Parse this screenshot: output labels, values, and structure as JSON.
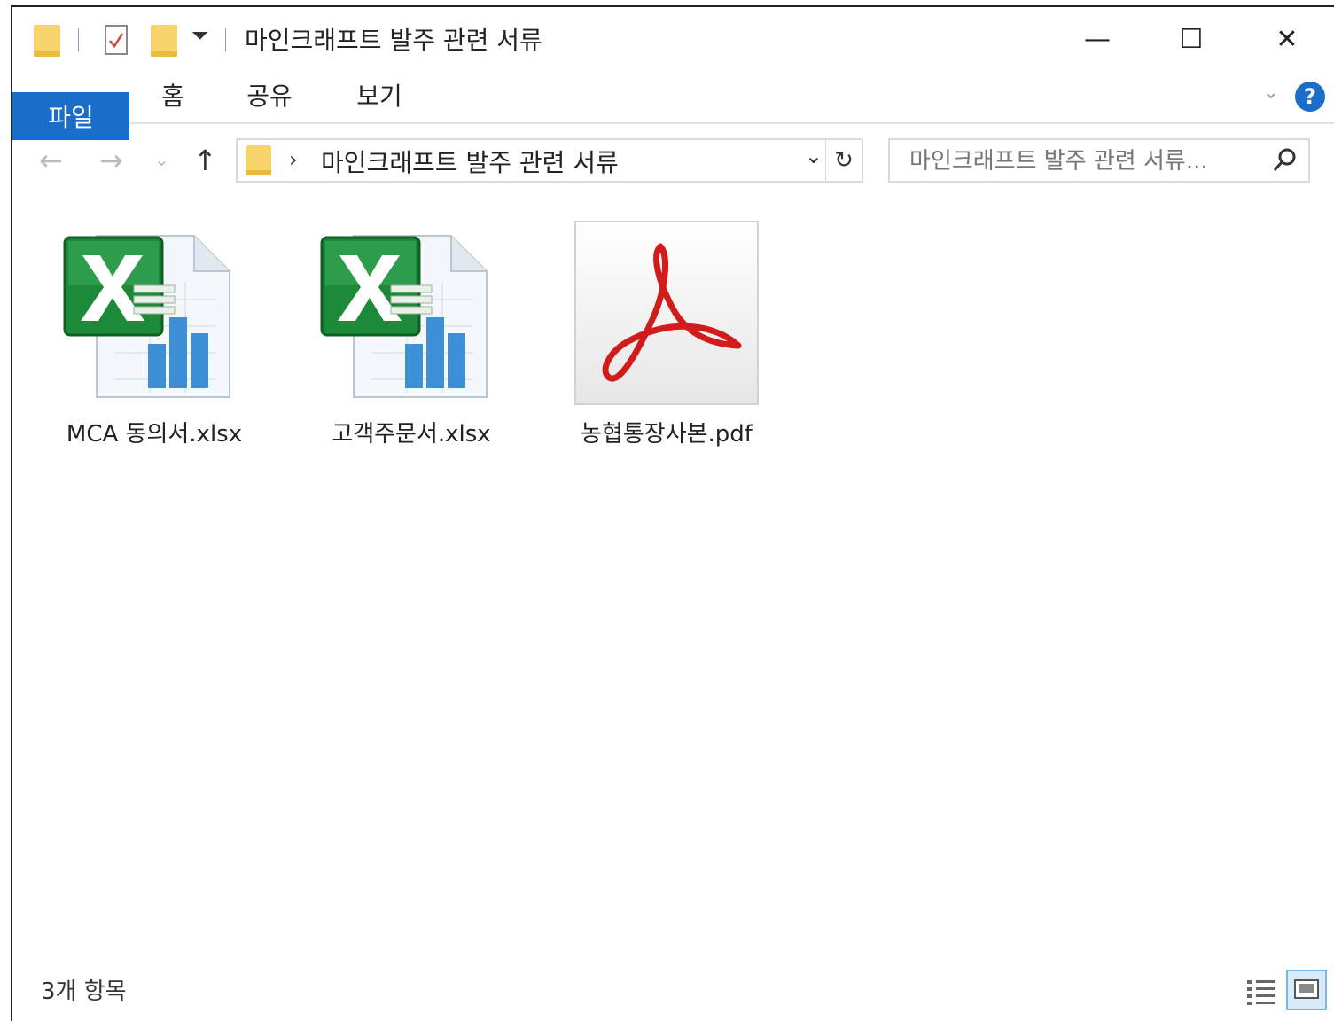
{
  "window": {
    "title": "마인크래프트 발주 관련 서류",
    "minimize_glyph": "—",
    "maximize_glyph": "☐",
    "close_glyph": "✕"
  },
  "quick_access": {
    "dropdown_glyph": "⏷"
  },
  "ribbon": {
    "tabs": [
      {
        "label": "파일"
      },
      {
        "label": "홈"
      },
      {
        "label": "공유"
      },
      {
        "label": "보기"
      }
    ],
    "collapse_glyph": "⌄",
    "help_glyph": "?"
  },
  "navigation": {
    "back_glyph": "←",
    "forward_glyph": "→",
    "recent_glyph": "⌄",
    "up_glyph": "↑",
    "address_separator": "›",
    "address_crumb": "마인크래프트 발주 관련 서류",
    "address_dropdown_glyph": "⌄",
    "refresh_glyph": "↻",
    "search_placeholder": "마인크래프트 발주 관련 서류..."
  },
  "files": [
    {
      "name": "MCA 동의서.xlsx",
      "type": "excel"
    },
    {
      "name": "고객주문서.xlsx",
      "type": "excel"
    },
    {
      "name": "농협통장사본.pdf",
      "type": "pdf"
    }
  ],
  "status": {
    "item_count": "3개 항목"
  },
  "colors": {
    "accent": "#1a6ec9",
    "folder": "#f7d46a",
    "excel_green": "#1d8a3a",
    "pdf_red": "#d21b1b"
  }
}
